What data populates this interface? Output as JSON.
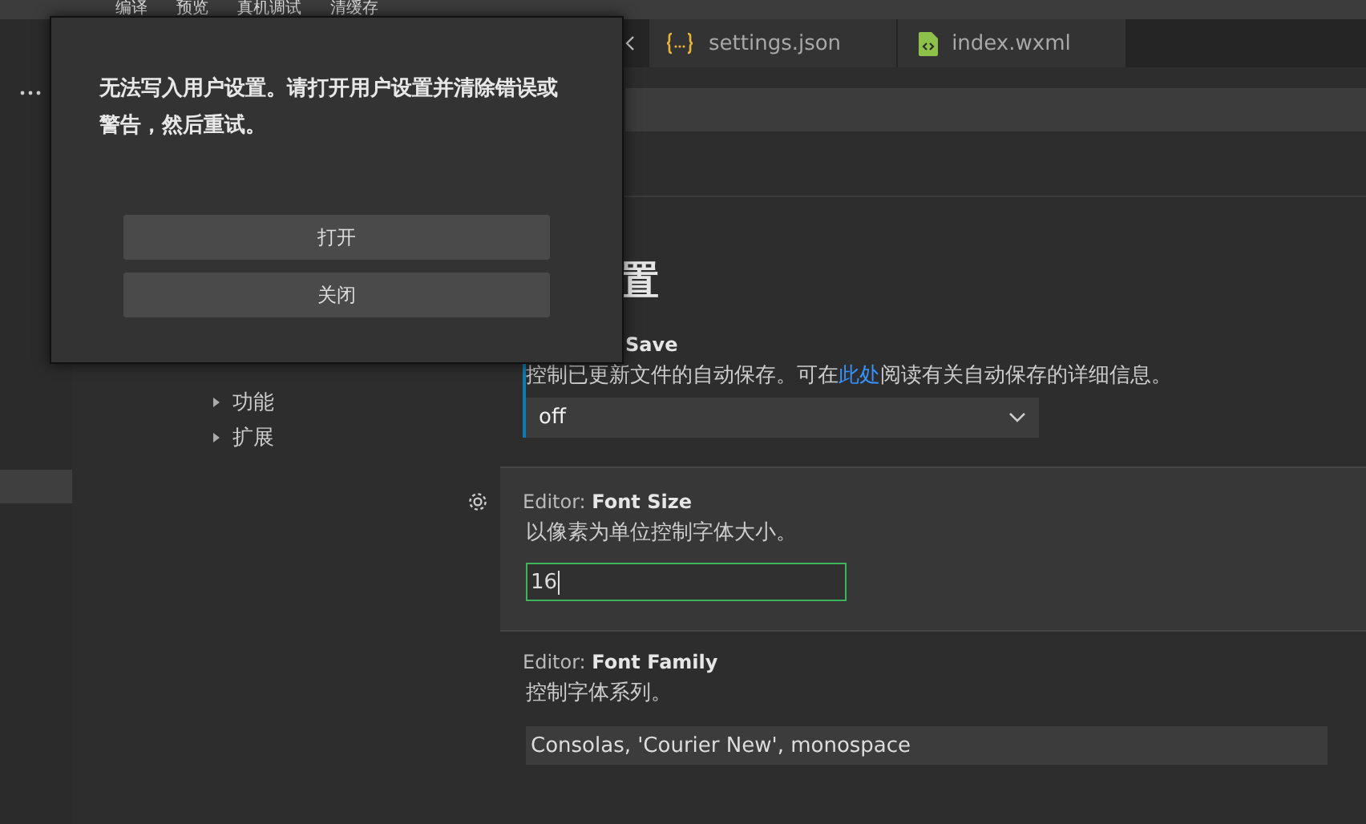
{
  "menu": [
    {
      "label": "编译"
    },
    {
      "label": "预览"
    },
    {
      "label": "真机调试"
    },
    {
      "label": "清缓存"
    }
  ],
  "tabs": [
    {
      "label": "settings.json",
      "kind": "json",
      "selected": false
    },
    {
      "label": "index.wxml",
      "kind": "wxml",
      "selected": false
    }
  ],
  "toc": [
    {
      "label": "功能",
      "expanded": false
    },
    {
      "label": "扩展",
      "expanded": false
    }
  ],
  "heading": "置",
  "settings": [
    {
      "kind": "select",
      "name": "Save",
      "description": "控制已更新文件的自动保存。可在",
      "link": "此处",
      "description_after": "阅读有关自动保存的详细信息。",
      "value": "off",
      "modified": true
    },
    {
      "kind": "number",
      "category": "Editor: ",
      "name": "Font Size",
      "description": "以像素为单位控制字体大小。",
      "value": "16",
      "modified": false,
      "focused": true
    },
    {
      "kind": "text",
      "category": "Editor: ",
      "name": "Font Family",
      "description": "控制字体系列。",
      "value": "Consolas, 'Courier New', monospace",
      "modified": false,
      "focused": false
    }
  ],
  "dialog": {
    "message": "无法写入用户设置。请打开用户设置并清除错误或警告，然后重试。",
    "buttons": [
      {
        "label": "打开"
      },
      {
        "label": "关闭"
      }
    ]
  }
}
